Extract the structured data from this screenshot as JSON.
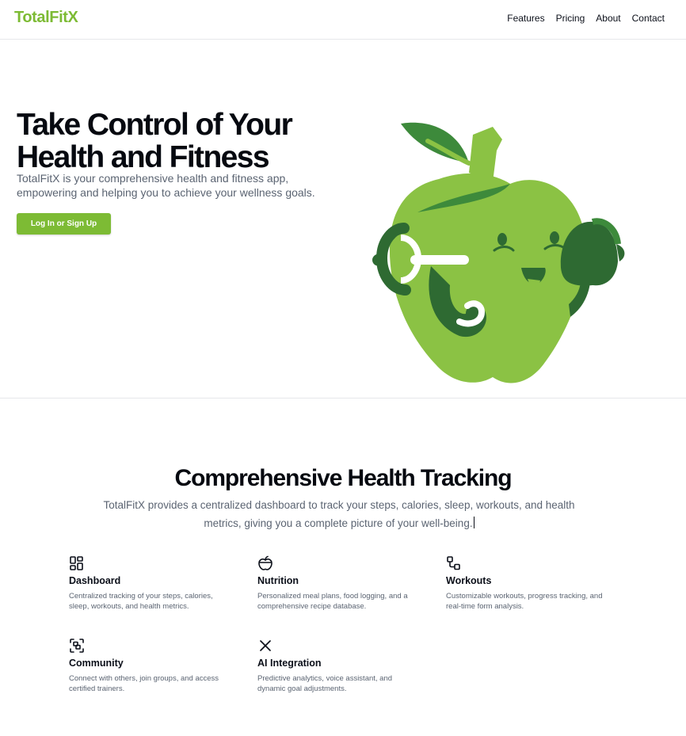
{
  "nav": {
    "brand": "TotalFitX",
    "links": [
      "Features",
      "Pricing",
      "About",
      "Contact"
    ]
  },
  "hero": {
    "title_line1": "Take Control of Your",
    "title_line2": "Health and Fitness",
    "subtitle": "TotalFitX is your comprehensive health and fitness app, empowering and helping you to achieve your wellness goals.",
    "cta_label": "Log In or Sign Up",
    "illustration": "apple-with-dumbbell-illustration"
  },
  "section": {
    "title": "Comprehensive Health Tracking",
    "subtitle": "TotalFitX provides a centralized dashboard to track your steps, calories, sleep, workouts, and health metrics, giving you a complete picture of your well-being."
  },
  "features": [
    {
      "icon": "dashboard-grid-icon",
      "title": "Dashboard",
      "desc": "Centralized tracking of your steps, calories, sleep, workouts, and health metrics."
    },
    {
      "icon": "apple-icon",
      "title": "Nutrition",
      "desc": "Personalized meal plans, food logging, and a comprehensive recipe database."
    },
    {
      "icon": "workflow-icon",
      "title": "Workouts",
      "desc": "Customizable workouts, progress tracking, and real-time form analysis."
    },
    {
      "icon": "scan-group-icon",
      "title": "Community",
      "desc": "Connect with others, join groups, and access certified trainers."
    },
    {
      "icon": "close-x-icon",
      "title": "AI Integration",
      "desc": "Predictive analytics, voice assistant, and dynamic goal adjustments."
    }
  ],
  "colors": {
    "accent": "#7dbb34",
    "apple_green": "#8bc244",
    "dark_green": "#2e6a32",
    "text": "#0b0f19",
    "muted": "#5b6472"
  }
}
